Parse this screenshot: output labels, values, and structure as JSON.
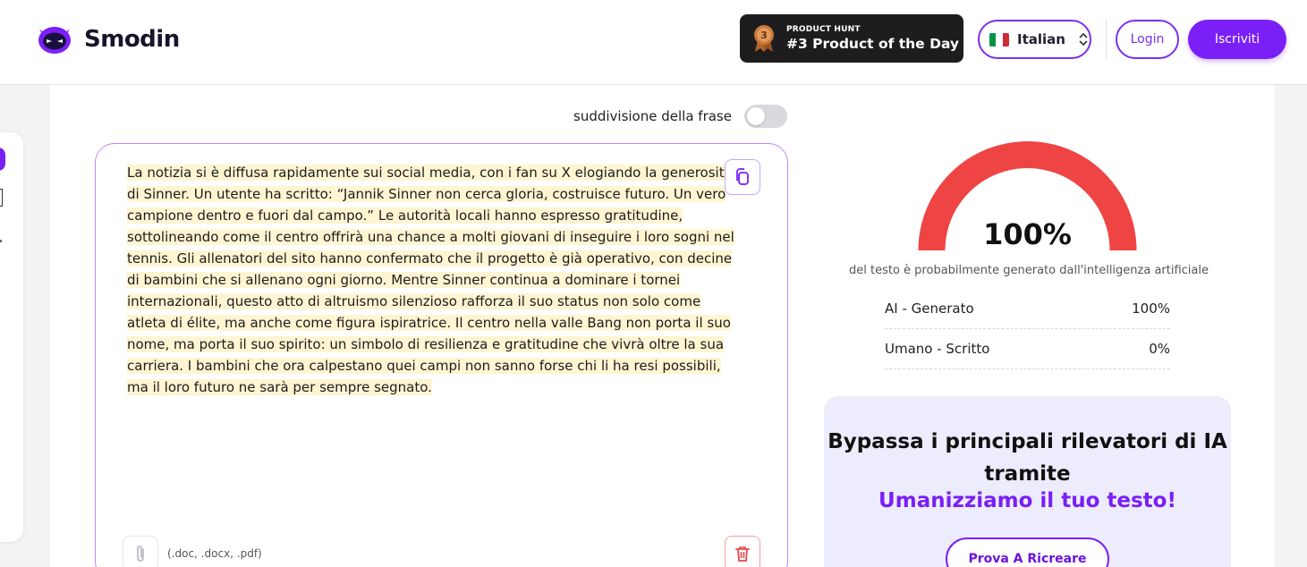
{
  "header": {
    "brand": "Smodin",
    "product_hunt": {
      "small_label": "PRODUCT HUNT",
      "title": "#3 Product of the Day",
      "rank": "3"
    },
    "language": {
      "label": "Italian",
      "flag_colors": [
        "#009246",
        "#ffffff",
        "#ce2b37"
      ]
    },
    "login_label": "Login",
    "signup_label": "Iscriviti"
  },
  "editor": {
    "split_toggle_label": "suddivisione della frase",
    "split_toggle_on": false,
    "text": "La notizia si è diffusa rapidamente sui social media, con i fan su X elogiando la generosità di Sinner. Un utente ha scritto: “Jannik Sinner non cerca gloria, costruisce futuro. Un vero campione dentro e fuori dal campo.” Le autorità locali hanno espresso gratitudine, sottolineando come il centro offrirà una chance a molti giovani di inseguire i loro sogni nel tennis. Gli allenatori del sito hanno confermato che il progetto è già operativo, con decine di bambini che si allenano ogni giorno. Mentre Sinner continua a dominare i tornei internazionali, questo atto di altruismo silenzioso rafforza il suo status non solo come atleta di élite, ma anche come figura ispiratrice. Il centro nella valle Bang non porta il suo nome, ma porta il suo spirito: un simbolo di resilienza e gratitudine che vivrà oltre la sua carriera. I bambini che ora calpestano quei campi non sanno forse chi li ha resi possibili, ma il loro futuro ne sarà per sempre segnato.",
    "file_types": "(.doc, .docx, .pdf)"
  },
  "result": {
    "gauge_value": 100,
    "percent_label": "100%",
    "caption": "del testo è probabilmente generato dall'intelligenza artificiale",
    "gauge_color": "#ef4444",
    "stats": [
      {
        "label": "AI - Generato",
        "value": "100%"
      },
      {
        "label": "Umano - Scritto",
        "value": "0%"
      }
    ]
  },
  "promo": {
    "title": "Bypassa i principali rilevatori di IA tramite",
    "subtitle": "Umanizziamo il tuo testo!",
    "button_label": "Prova A Ricreare"
  },
  "colors": {
    "accent": "#7a1ff5",
    "highlight": "#fff5d2"
  }
}
